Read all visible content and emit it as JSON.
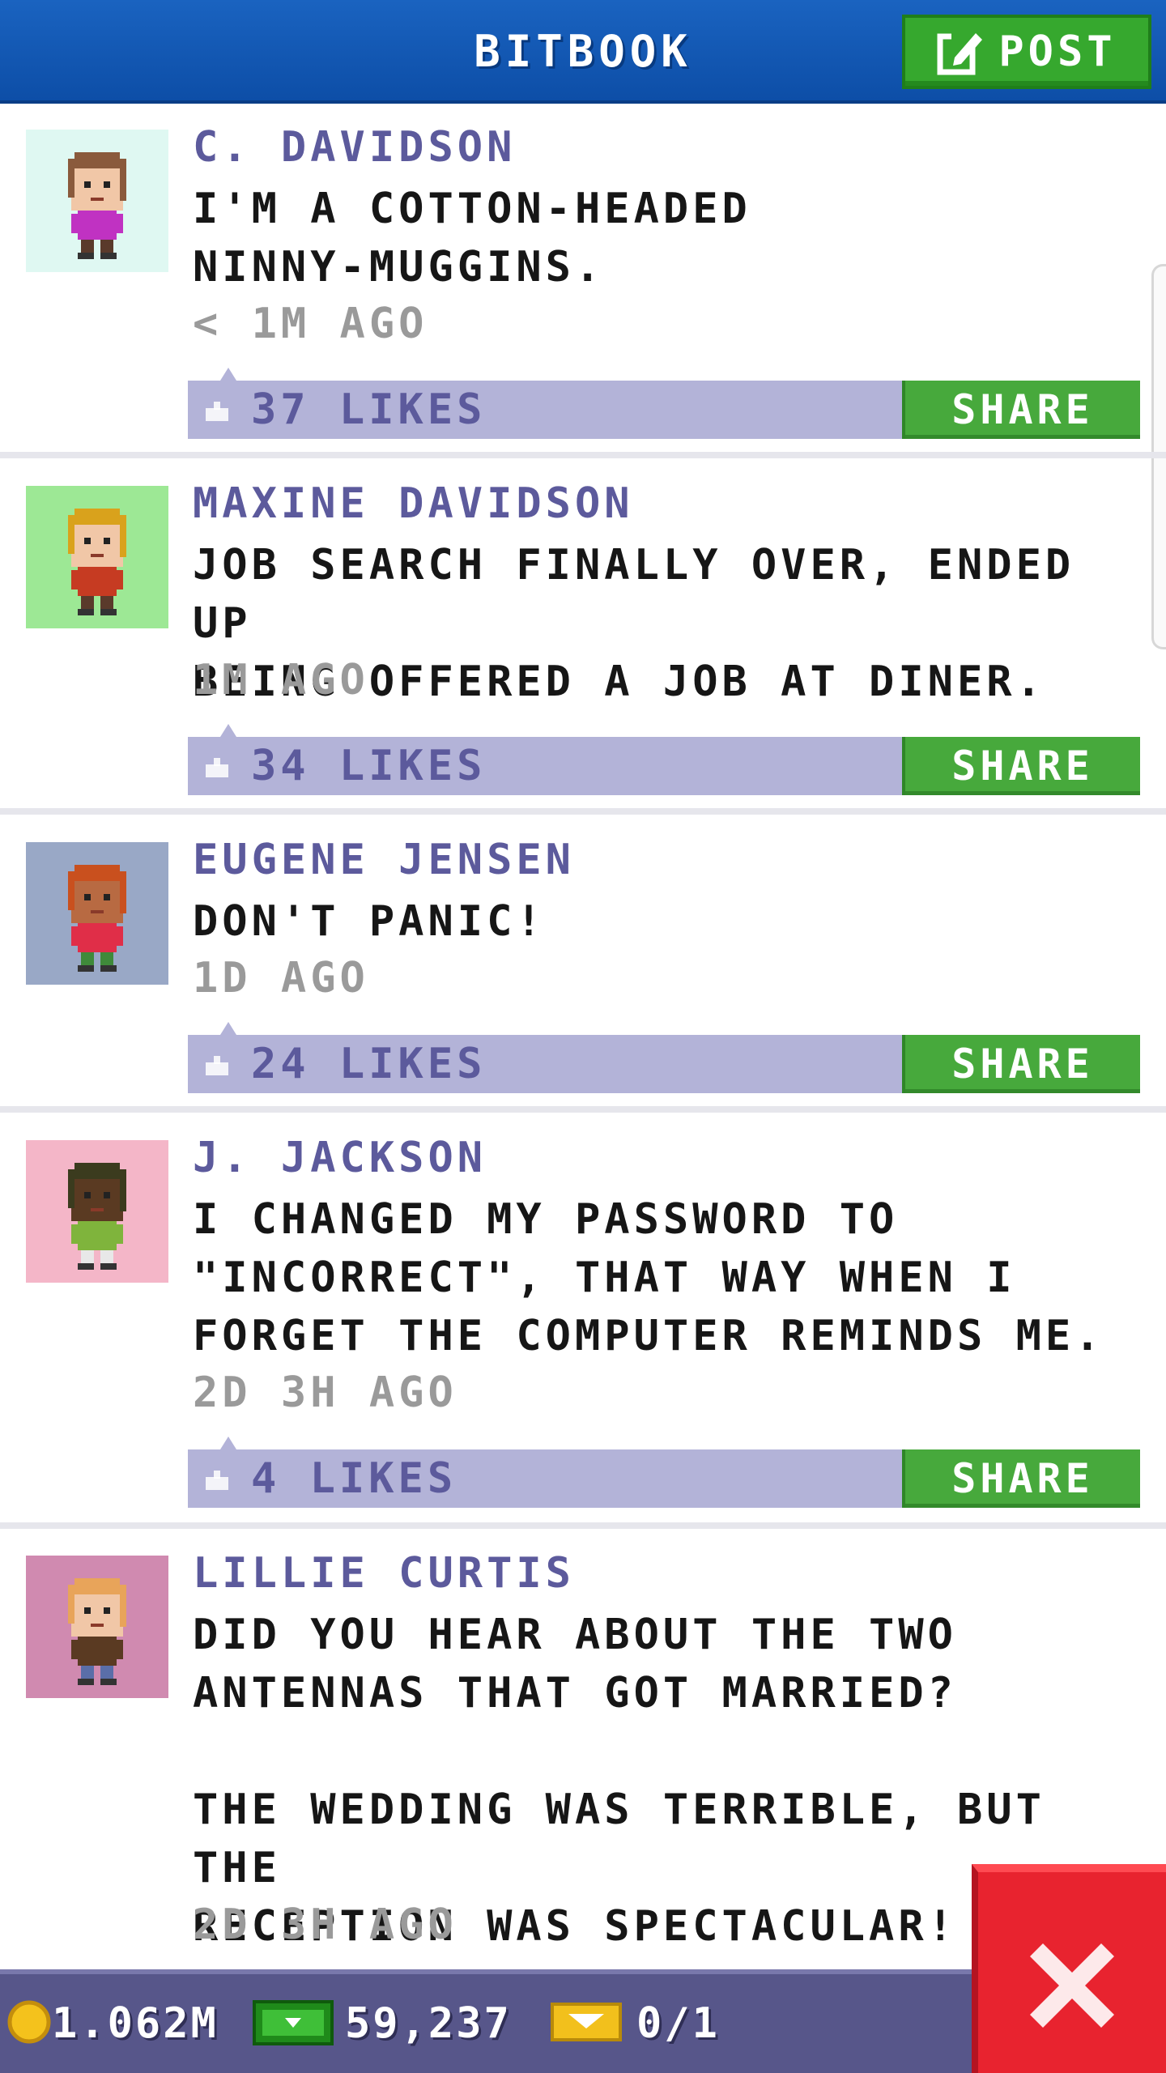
{
  "header": {
    "title": "BITBOOK",
    "post_label": "POST"
  },
  "posts": [
    {
      "author": "C. DAVIDSON",
      "message": "I'M A COTTON-HEADED\nNINNY-MUGGINS.",
      "time": "< 1M AGO",
      "likes": "37 LIKES",
      "share": "SHARE",
      "avatar": {
        "bg": "#dff8f2",
        "skin": "#f1c7a7",
        "hair": "#8a5a3c",
        "shirt": "#c032c2",
        "pants": "#5a3a2b"
      }
    },
    {
      "author": "MAXINE DAVIDSON",
      "message": "JOB SEARCH FINALLY OVER, ENDED UP\nBEING OFFERED A JOB AT DINER.",
      "time": "1M AGO",
      "likes": "34 LIKES",
      "share": "SHARE",
      "avatar": {
        "bg": "#9de895",
        "skin": "#f1c7a7",
        "hair": "#d9a21c",
        "shirt": "#c63b22",
        "pants": "#5a3a2b"
      }
    },
    {
      "author": "EUGENE JENSEN",
      "message": "DON'T PANIC!",
      "time": "1D AGO",
      "likes": "24 LIKES",
      "share": "SHARE",
      "avatar": {
        "bg": "#99a8c6",
        "skin": "#b86a42",
        "hair": "#c9501e",
        "shirt": "#e02e48",
        "pants": "#3f8a3a"
      }
    },
    {
      "author": "J. JACKSON",
      "message": "I CHANGED MY PASSWORD TO\n\"INCORRECT\", THAT WAY WHEN I\nFORGET THE COMPUTER REMINDS ME.",
      "time": "2D 3H AGO",
      "likes": "4 LIKES",
      "share": "SHARE",
      "avatar": {
        "bg": "#f4b6c8",
        "skin": "#5a3a22",
        "hair": "#3b3b1e",
        "shirt": "#7fb43c",
        "pants": "#e8e8e8"
      }
    },
    {
      "author": "LILLIE CURTIS",
      "message": "DID YOU HEAR ABOUT THE TWO\nANTENNAS THAT GOT MARRIED?\n\nTHE WEDDING WAS TERRIBLE, BUT THE\nRECEPTION WAS SPECTACULAR!",
      "time": "2D 3H AGO",
      "likes": "",
      "share": "",
      "avatar": {
        "bg": "#d08ab0",
        "skin": "#f1c7a7",
        "hair": "#e8a45a",
        "shirt": "#5a3a22",
        "pants": "#5a6ea8"
      }
    }
  ],
  "status": {
    "coins": "1.062M",
    "bux": "59,237",
    "tickets": "0/1"
  },
  "icons": {
    "post": "edit-icon",
    "like": "thumbs-up-icon",
    "coin": "coin-icon",
    "bux": "bux-icon",
    "ticket": "ticket-icon",
    "close": "close-icon"
  },
  "colors": {
    "header": "#1a63c0",
    "accent_green": "#47a93c",
    "like_bar": "#b3b3d8",
    "author": "#5c5a9c",
    "close": "#e8232f"
  }
}
